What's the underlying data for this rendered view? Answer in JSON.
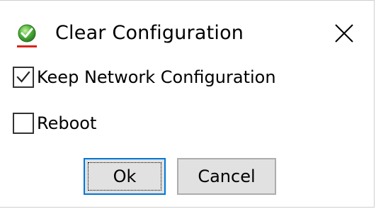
{
  "dialog": {
    "title": "Clear Configuration",
    "app_icon": "green-checkmark-shield-icon",
    "close_icon": "close-icon"
  },
  "options": [
    {
      "label": "Keep Network Configuration",
      "checked": true
    },
    {
      "label": "Reboot",
      "checked": false
    }
  ],
  "buttons": {
    "ok_label": "Ok",
    "cancel_label": "Cancel"
  },
  "colors": {
    "accent": "#0078d7",
    "button_face": "#e1e1e1",
    "button_border": "#adadad",
    "icon_green": "#3fa535",
    "icon_red_underline": "#d9241b"
  }
}
